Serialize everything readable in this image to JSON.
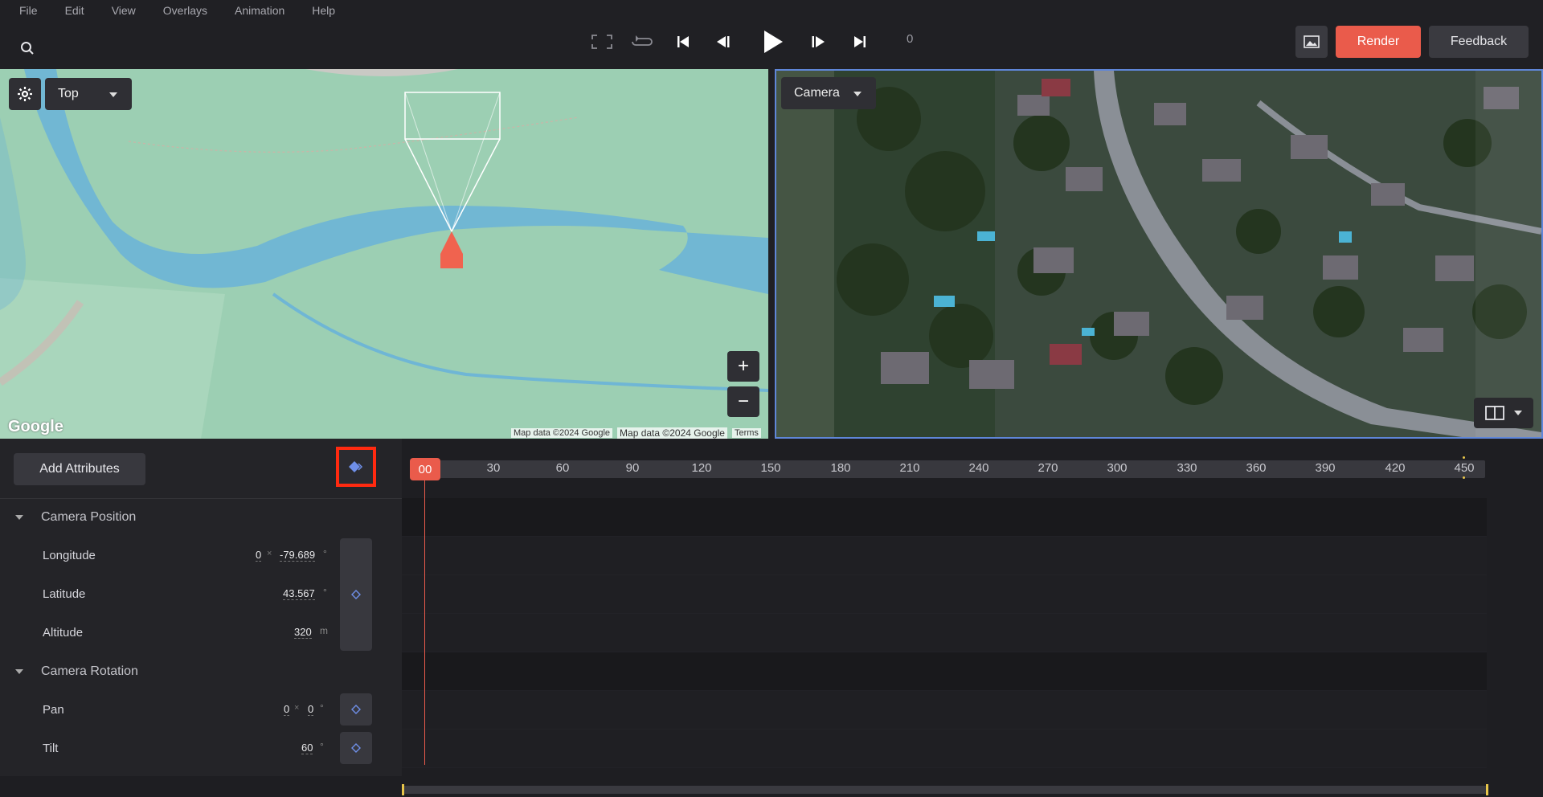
{
  "menu": [
    "File",
    "Edit",
    "View",
    "Overlays",
    "Animation",
    "Help"
  ],
  "toolbar": {
    "frame_counter": "0",
    "render_label": "Render",
    "feedback_label": "Feedback"
  },
  "viewport_left": {
    "view_label": "Top",
    "zoom_in": "+",
    "zoom_out": "−",
    "google_logo": "Google",
    "attribution_1": "Map data ©2024 Google",
    "attribution_2": "Map data ©2024 Google",
    "terms": "Terms"
  },
  "viewport_right": {
    "view_label": "Camera"
  },
  "panel": {
    "add_attributes_label": "Add Attributes",
    "groups": [
      {
        "label": "Camera Position"
      },
      {
        "label": "Camera Rotation"
      }
    ],
    "attributes": {
      "longitude": {
        "label": "Longitude",
        "mult": "0",
        "times": "×",
        "value": "-79.689",
        "unit": "°"
      },
      "latitude": {
        "label": "Latitude",
        "value": "43.567",
        "unit": "°"
      },
      "altitude": {
        "label": "Altitude",
        "value": "320",
        "unit": "m"
      },
      "pan": {
        "label": "Pan",
        "mult": "0",
        "times": "×",
        "value": "0",
        "unit": "°"
      },
      "tilt": {
        "label": "Tilt",
        "value": "60",
        "unit": "°"
      }
    }
  },
  "timeline": {
    "playhead_label": "00",
    "ticks": [
      "30",
      "60",
      "90",
      "120",
      "150",
      "180",
      "210",
      "240",
      "270",
      "300",
      "330",
      "360",
      "390",
      "420",
      "450"
    ]
  },
  "colors": {
    "accent": "#ea5b4b",
    "keyframe": "#6f8fe8",
    "highlight": "#ff2a10"
  }
}
